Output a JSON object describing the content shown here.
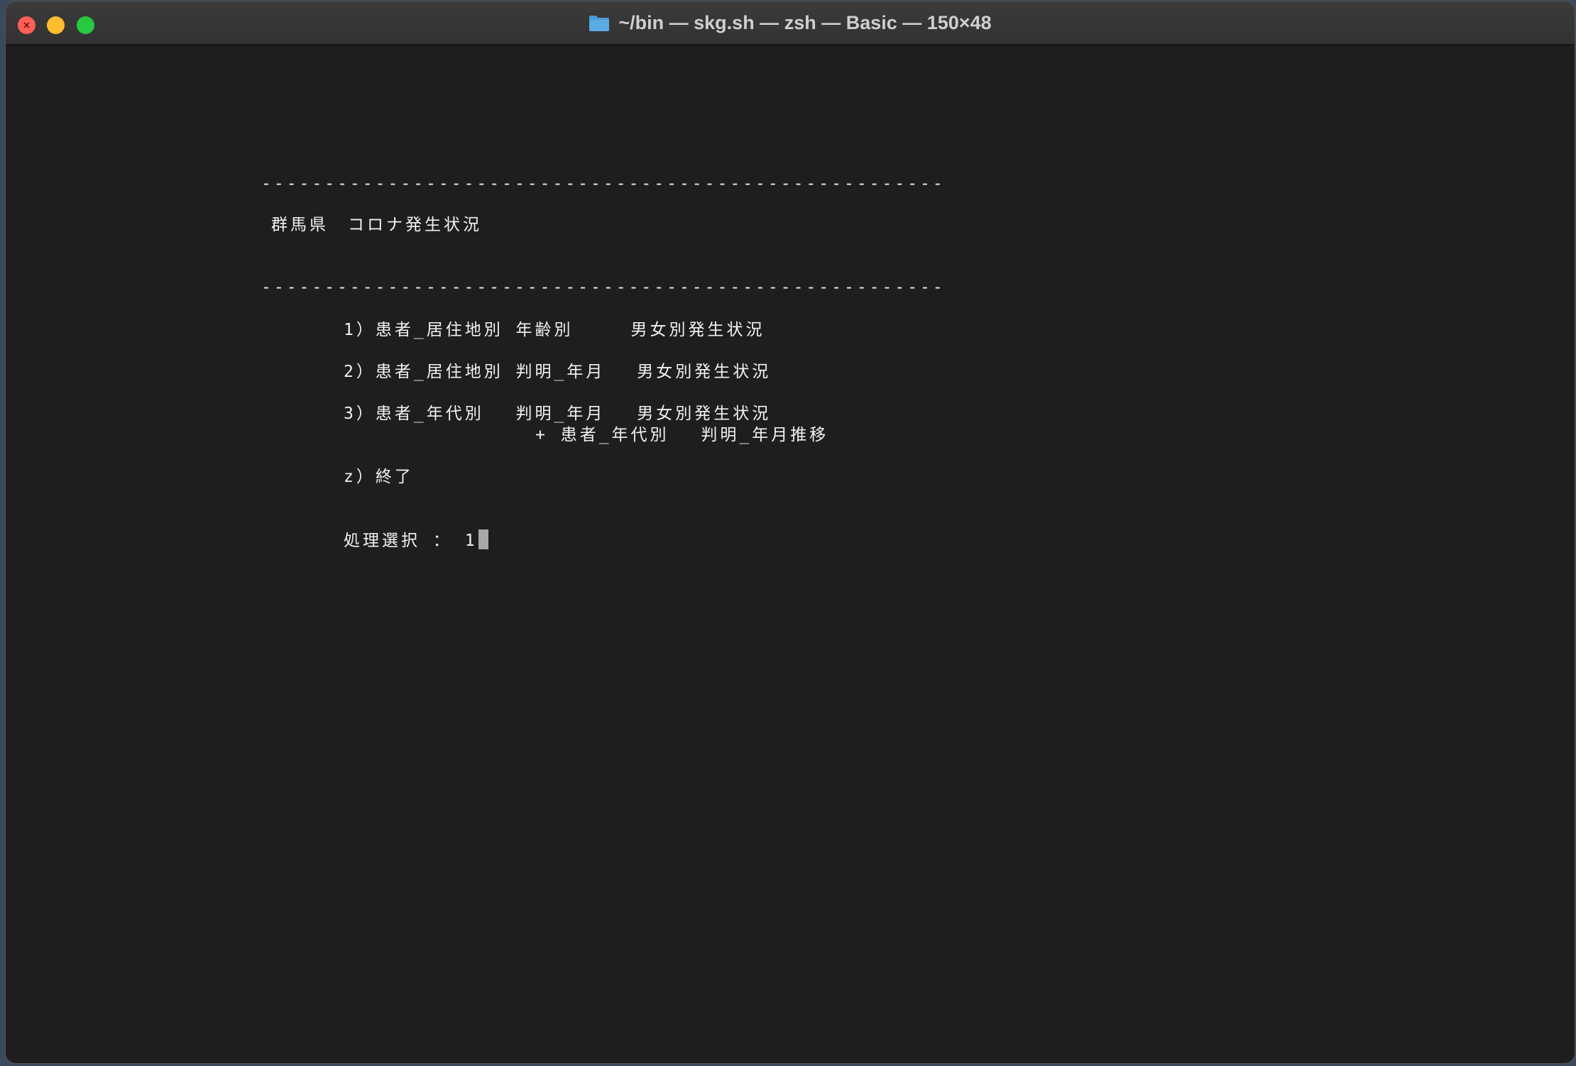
{
  "window": {
    "title": "~/bin — skg.sh — zsh — Basic — 150×48",
    "folder_icon": "folder-icon",
    "colors": {
      "background": "#1e1e1e",
      "text": "#f2f2f2",
      "close": "#ff5f57",
      "minimize": "#febc2e",
      "zoom": "#28c840"
    }
  },
  "terminal": {
    "separator_top": "------------------------------------------------------",
    "heading": "群馬県　コロナ発生状況",
    "separator_bottom": "------------------------------------------------------",
    "menu": [
      "1）患者_居住地別 年齢別　　　男女別発生状況",
      "2）患者_居住地別 判明_年月　 男女別発生状況",
      "3）患者_年代別　 判明_年月　 男女別発生状況",
      "　　　　　　　　　　+ 患者_年代別　 判明_年月推移",
      "z）終了"
    ],
    "prompt_label": "処理選択 ：",
    "prompt_input": "1"
  }
}
